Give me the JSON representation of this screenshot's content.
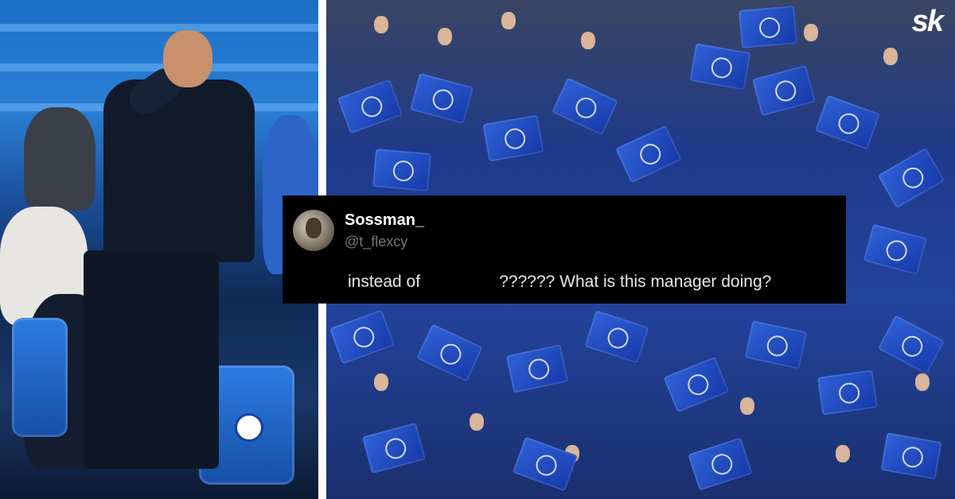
{
  "brand": {
    "logo_text": "sk"
  },
  "tweet": {
    "display_name": "Sossman_",
    "handle": "@t_flexcy",
    "text": "instead of                 ?????? What is this manager doing?"
  },
  "photos": {
    "left": "manager-on-touchline",
    "right": "chelsea-fans-waving-flags"
  },
  "colors": {
    "chelsea_blue": "#1a4fc0",
    "tweet_background": "#000000",
    "handle_gray": "#71767b"
  }
}
